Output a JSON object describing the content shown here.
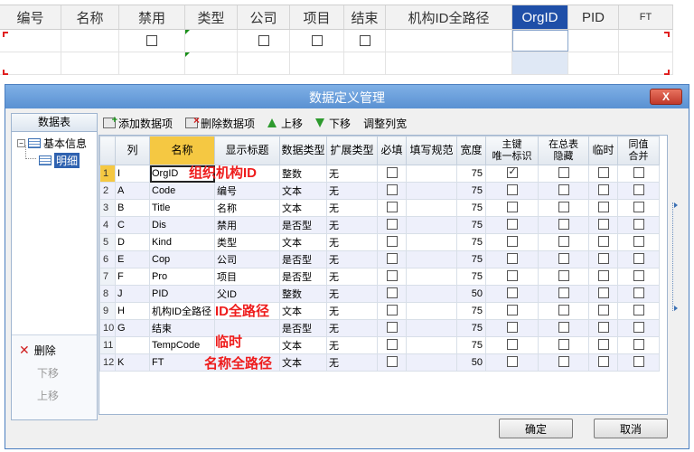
{
  "sheet": {
    "headers": [
      "编号",
      "名称",
      "禁用",
      "类型",
      "公司",
      "项目",
      "结束",
      "机构ID全路径",
      "OrgID",
      "PID",
      "FT"
    ],
    "selected_header": "OrgID"
  },
  "dialog": {
    "title": "数据定义管理",
    "close_label": "X",
    "left_panel": {
      "header": "数据表",
      "tree_root": "基本信息",
      "tree_child": "明细",
      "delete_label": "删除",
      "move_down_label": "下移",
      "move_up_label": "上移"
    },
    "toolbar": {
      "add_label": "添加数据项",
      "delete_label": "删除数据项",
      "up_label": "上移",
      "down_label": "下移",
      "adjust_label": "调整列宽"
    },
    "grid": {
      "columns": [
        "列",
        "名称",
        "显示标题",
        "数据类型",
        "扩展类型",
        "必填",
        "填写规范",
        "宽度",
        "主键\n唯一标识",
        "在总表\n隐藏",
        "临时",
        "同值\n合并"
      ],
      "rows": [
        {
          "n": "1",
          "col": "I",
          "name": "OrgID",
          "title": "",
          "dtype": "整数",
          "ext": "无",
          "width": "75",
          "pk": true
        },
        {
          "n": "2",
          "col": "A",
          "name": "Code",
          "title": "编号",
          "dtype": "文本",
          "ext": "无",
          "width": "75",
          "pk": false
        },
        {
          "n": "3",
          "col": "B",
          "name": "Title",
          "title": "名称",
          "dtype": "文本",
          "ext": "无",
          "width": "75",
          "pk": false
        },
        {
          "n": "4",
          "col": "C",
          "name": "Dis",
          "title": "禁用",
          "dtype": "是否型",
          "ext": "无",
          "width": "75",
          "pk": false
        },
        {
          "n": "5",
          "col": "D",
          "name": "Kind",
          "title": "类型",
          "dtype": "文本",
          "ext": "无",
          "width": "75",
          "pk": false
        },
        {
          "n": "6",
          "col": "E",
          "name": "Cop",
          "title": "公司",
          "dtype": "是否型",
          "ext": "无",
          "width": "75",
          "pk": false
        },
        {
          "n": "7",
          "col": "F",
          "name": "Pro",
          "title": "项目",
          "dtype": "是否型",
          "ext": "无",
          "width": "75",
          "pk": false
        },
        {
          "n": "8",
          "col": "J",
          "name": "PID",
          "title": "父ID",
          "dtype": "整数",
          "ext": "无",
          "width": "50",
          "pk": false
        },
        {
          "n": "9",
          "col": "H",
          "name": "机构ID全路径",
          "title": "",
          "dtype": "文本",
          "ext": "无",
          "width": "75",
          "pk": false
        },
        {
          "n": "10",
          "col": "G",
          "name": "结束",
          "title": "",
          "dtype": "是否型",
          "ext": "无",
          "width": "75",
          "pk": false
        },
        {
          "n": "11",
          "col": "",
          "name": "TempCode",
          "title": "",
          "dtype": "文本",
          "ext": "无",
          "width": "75",
          "pk": false
        },
        {
          "n": "12",
          "col": "K",
          "name": "FT",
          "title": "",
          "dtype": "文本",
          "ext": "无",
          "width": "50",
          "pk": false
        }
      ]
    },
    "annotations": {
      "orgid": "组织机构ID",
      "idpath": "ID全路径",
      "temp": "临时",
      "namepath": "名称全路径"
    },
    "ok_label": "确定",
    "cancel_label": "取消"
  },
  "colors": {
    "title_bar": "#5a91d2",
    "selected_header": "#1f4fa8",
    "highlight": "#f5c842",
    "annotation": "#ee1c1c",
    "close_button": "#c0392b"
  }
}
